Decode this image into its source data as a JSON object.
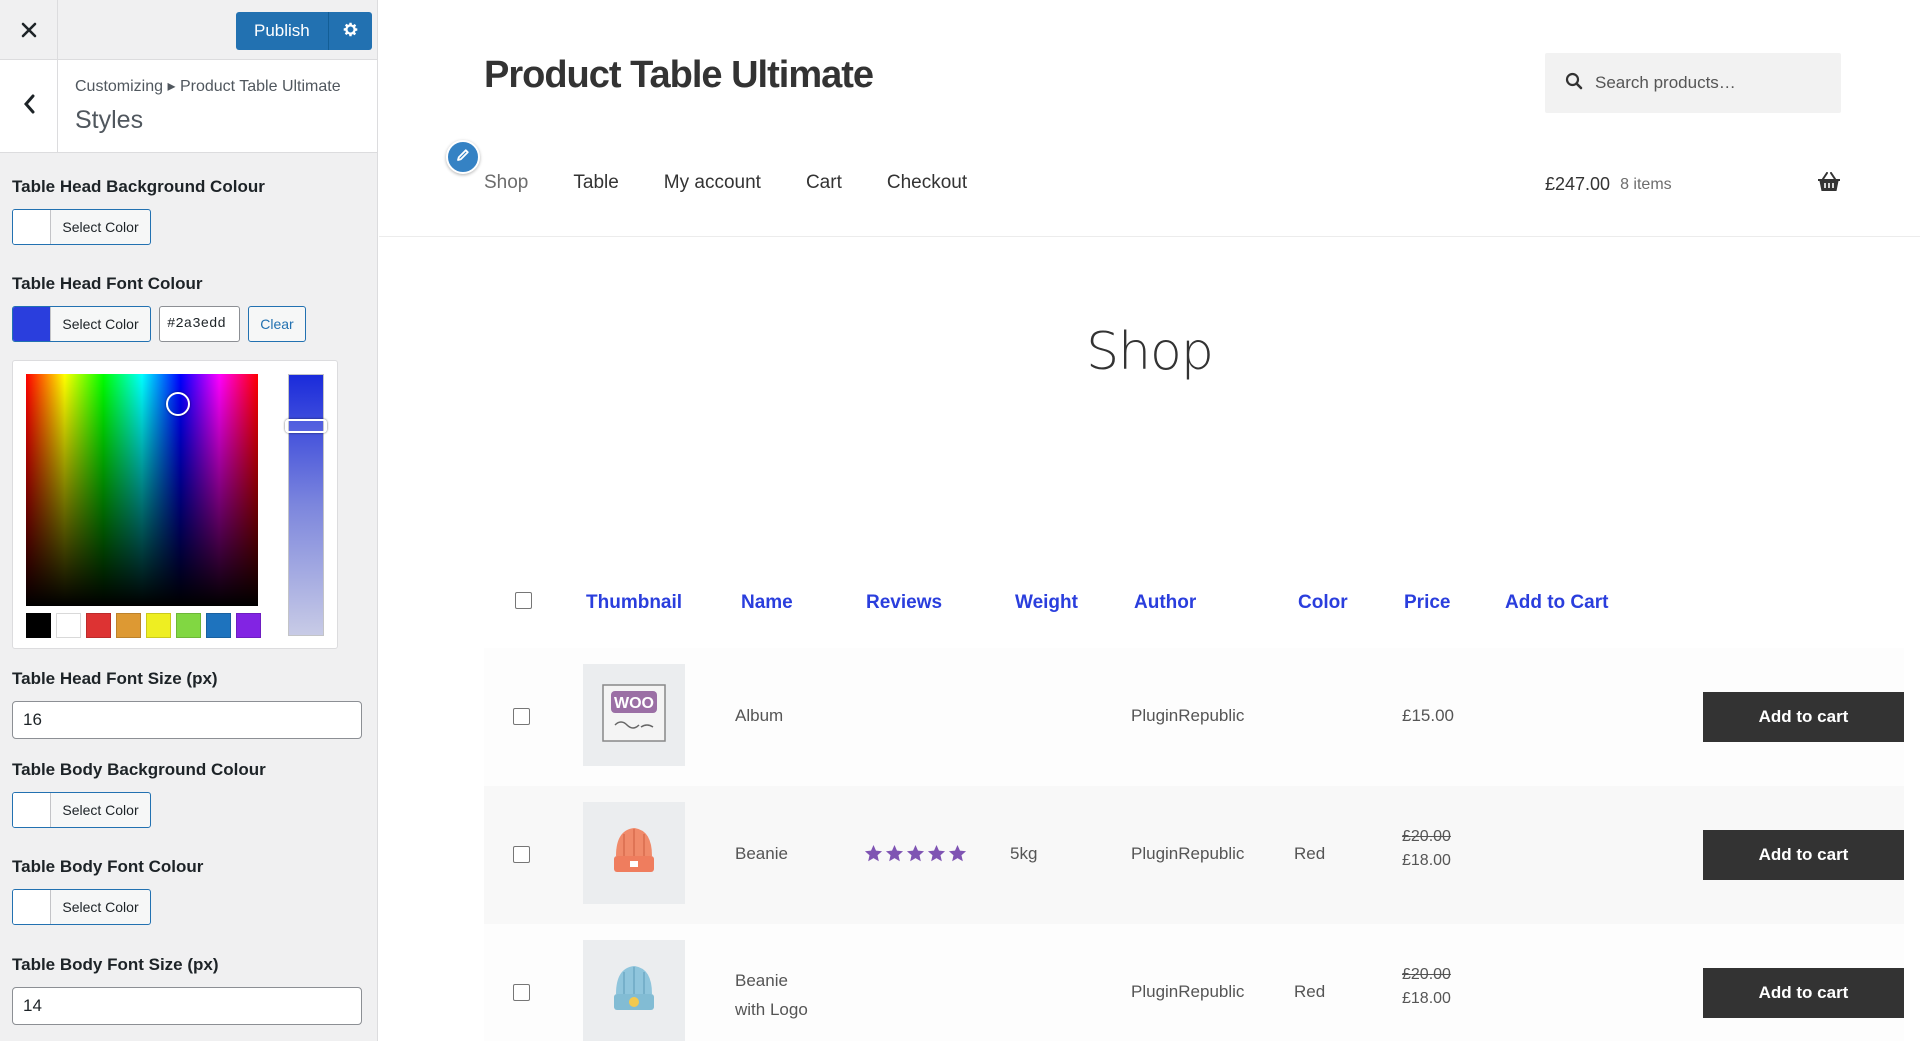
{
  "customizer": {
    "publish_label": "Publish",
    "breadcrumb": "Customizing ▸ Product Table Ultimate",
    "section_title": "Styles",
    "controls": {
      "head_bg": {
        "label": "Table Head Background Colour",
        "button": "Select Color",
        "swatch": "#ffffff"
      },
      "head_font": {
        "label": "Table Head Font Colour",
        "button": "Select Color",
        "swatch": "#2a3edd",
        "hex_value": "#2a3edd",
        "clear_label": "Clear"
      },
      "head_size": {
        "label": "Table Head Font Size (px)",
        "value": "16"
      },
      "body_bg": {
        "label": "Table Body Background Colour",
        "button": "Select Color",
        "swatch": "#ffffff"
      },
      "body_font": {
        "label": "Table Body Font Colour",
        "button": "Select Color",
        "swatch": "#ffffff"
      },
      "body_size": {
        "label": "Table Body Font Size (px)",
        "value": "14"
      }
    },
    "palette": [
      "#000000",
      "#ffffff",
      "#dd3333",
      "#dd9933",
      "#eeee22",
      "#81d742",
      "#1e73be",
      "#8224e3"
    ]
  },
  "site": {
    "title": "Product Table Ultimate",
    "search_placeholder": "Search products…",
    "nav": [
      "Shop",
      "Table",
      "My account",
      "Cart",
      "Checkout"
    ],
    "cart_total": "£247.00",
    "cart_count": "8 items",
    "page_heading": "Shop"
  },
  "table": {
    "head_color": "#2a3edd",
    "columns": [
      "Thumbnail",
      "Name",
      "Reviews",
      "Weight",
      "Author",
      "Color",
      "Price",
      "Add to Cart"
    ],
    "rows": [
      {
        "name": "Album",
        "name_line2": "",
        "rating": 0,
        "weight": "",
        "author": "PluginRepublic",
        "color": "",
        "price_old": "",
        "price": "£15.00",
        "button": "Add to cart",
        "thumb": "woo-album-icon"
      },
      {
        "name": "Beanie",
        "name_line2": "",
        "rating": 5,
        "weight": "5kg",
        "author": "PluginRepublic",
        "color": "Red",
        "price_old": "£20.00",
        "price": "£18.00",
        "button": "Add to cart",
        "thumb": "beanie-icon"
      },
      {
        "name": "Beanie",
        "name_line2": "with Logo",
        "rating": 0,
        "weight": "",
        "author": "PluginRepublic",
        "color": "Red",
        "price_old": "£20.00",
        "price": "£18.00",
        "button": "Add to cart",
        "thumb": "beanie-logo-icon"
      }
    ]
  }
}
